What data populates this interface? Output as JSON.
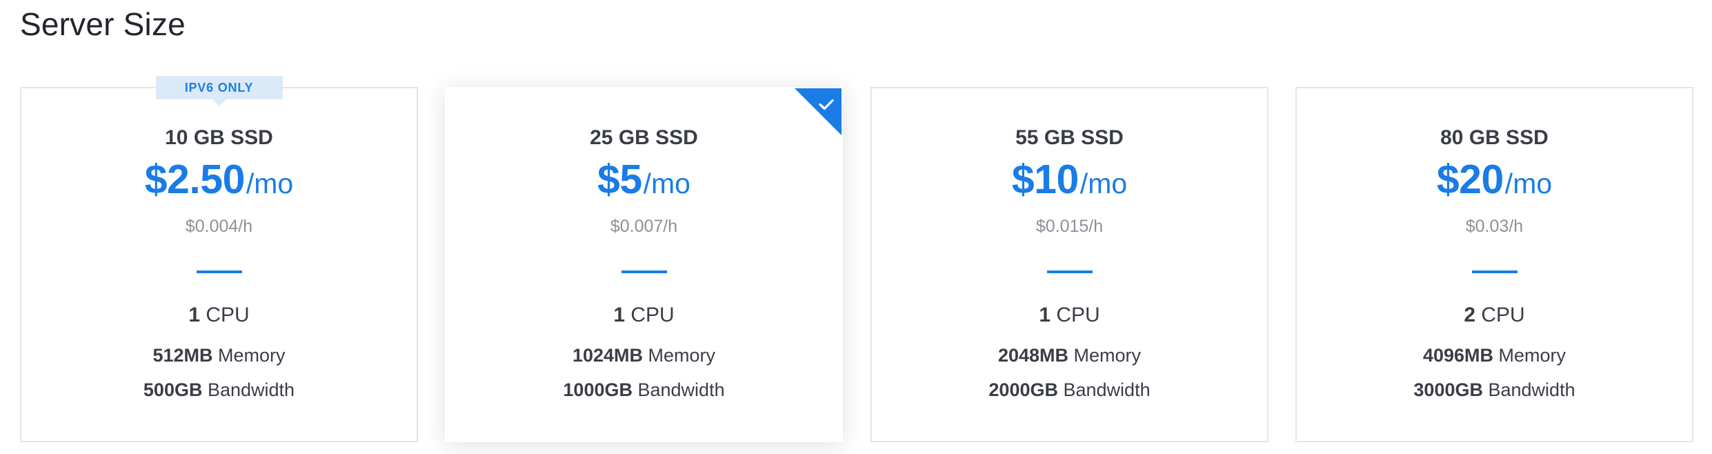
{
  "section": {
    "title": "Server Size"
  },
  "colors": {
    "accent": "#1a7ce6",
    "badge_bg": "#dbeaf8",
    "card_border": "#e3e5e9",
    "text_primary": "#3a3d45",
    "text_muted": "#8c9098"
  },
  "icons": {
    "selected_indicator": "checkmark-icon"
  },
  "plans": [
    {
      "disk": "10 GB SSD",
      "price_amount": "$2.50",
      "price_period": "/mo",
      "hourly": "$0.004/h",
      "badge": "IPv6 ONLY",
      "selected": false,
      "cpu_value": "1",
      "cpu_label": "CPU",
      "memory_value": "512MB",
      "memory_label": "Memory",
      "bandwidth_value": "500GB",
      "bandwidth_label": "Bandwidth"
    },
    {
      "disk": "25 GB SSD",
      "price_amount": "$5",
      "price_period": "/mo",
      "hourly": "$0.007/h",
      "selected": true,
      "cpu_value": "1",
      "cpu_label": "CPU",
      "memory_value": "1024MB",
      "memory_label": "Memory",
      "bandwidth_value": "1000GB",
      "bandwidth_label": "Bandwidth"
    },
    {
      "disk": "55 GB SSD",
      "price_amount": "$10",
      "price_period": "/mo",
      "hourly": "$0.015/h",
      "selected": false,
      "cpu_value": "1",
      "cpu_label": "CPU",
      "memory_value": "2048MB",
      "memory_label": "Memory",
      "bandwidth_value": "2000GB",
      "bandwidth_label": "Bandwidth"
    },
    {
      "disk": "80 GB SSD",
      "price_amount": "$20",
      "price_period": "/mo",
      "hourly": "$0.03/h",
      "selected": false,
      "cpu_value": "2",
      "cpu_label": "CPU",
      "memory_value": "4096MB",
      "memory_label": "Memory",
      "bandwidth_value": "3000GB",
      "bandwidth_label": "Bandwidth"
    }
  ]
}
